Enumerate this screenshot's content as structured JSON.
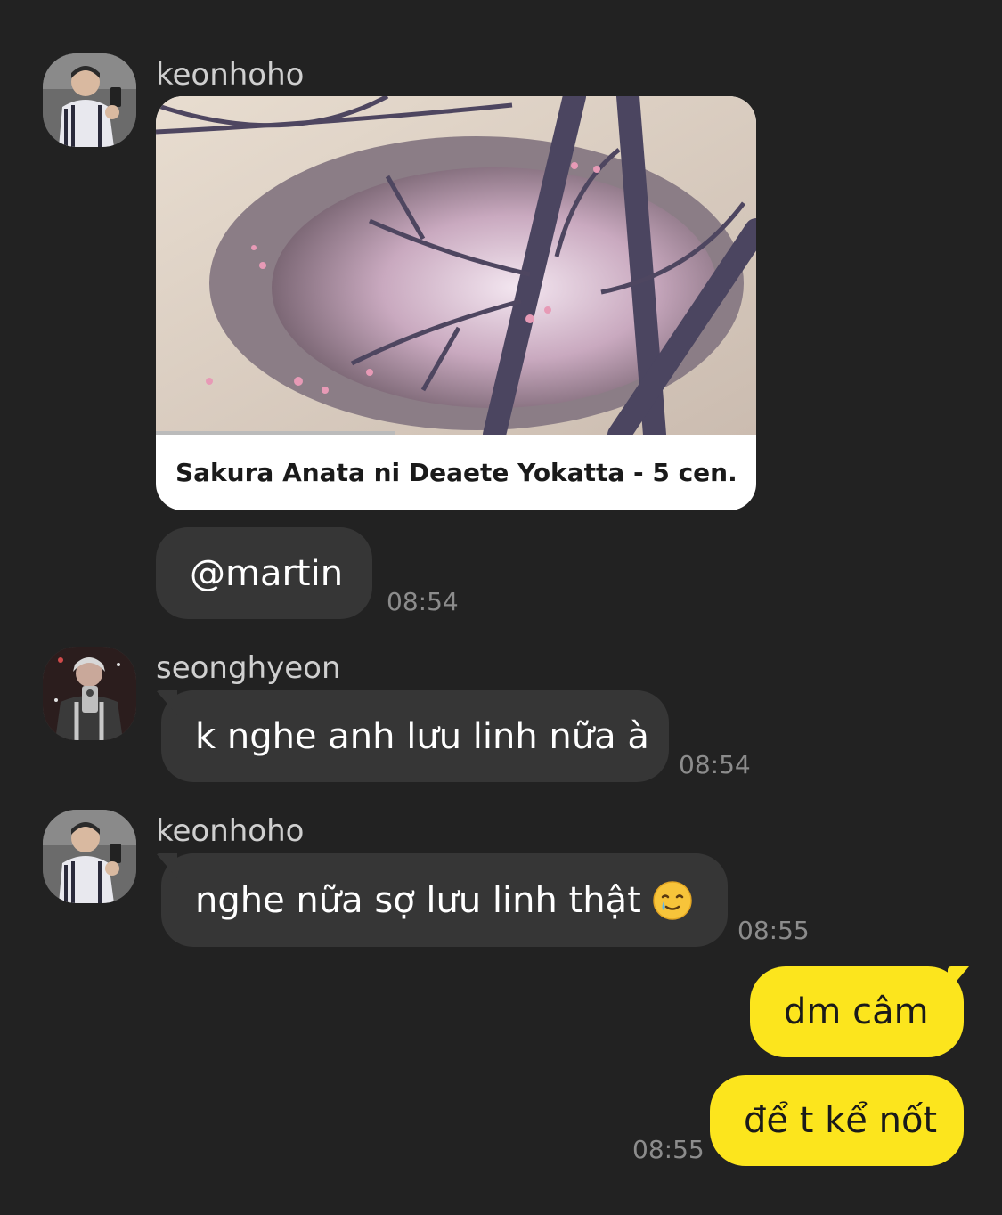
{
  "messages": [
    {
      "sender": "keonhoho",
      "link_card": {
        "title": "Sakura Anata ni Deaete Yokatta - 5 cen..."
      },
      "text": "@martin",
      "time": "08:54"
    },
    {
      "sender": "seonghyeon",
      "text": "k nghe anh lưu linh nữa à",
      "time": "08:54"
    },
    {
      "sender": "keonhoho",
      "text": "nghe nữa sợ lưu linh thật",
      "emoji": "smiling-face-with-tear-icon",
      "time": "08:55"
    }
  ],
  "my_messages": [
    {
      "text": "dm câm"
    },
    {
      "text": "để t kể nốt",
      "time": "08:55"
    }
  ],
  "colors": {
    "background": "#222222",
    "incoming_bubble": "#363636",
    "outgoing_bubble": "#fce51d",
    "timestamp": "#8c8c8c",
    "sender_name": "#cfcfcf"
  }
}
